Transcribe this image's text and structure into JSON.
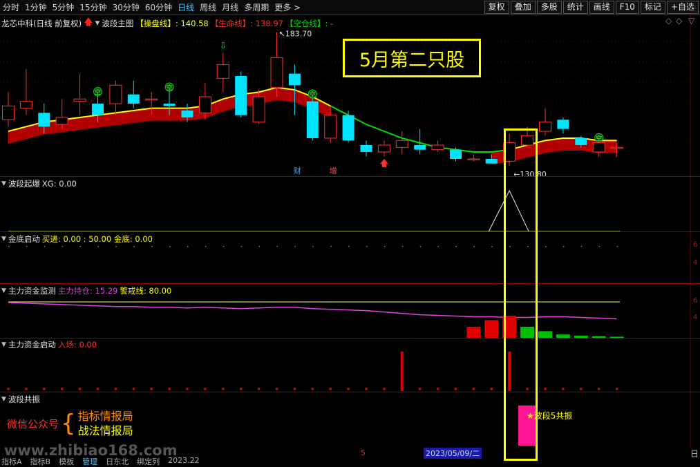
{
  "toolbar": {
    "periods": [
      "分时",
      "1分钟",
      "5分钟",
      "15分钟",
      "30分钟",
      "60分钟",
      "日线",
      "周线",
      "月线",
      "多周期",
      "更多 >"
    ],
    "active_period": "日线",
    "tools": [
      "复权",
      "叠加",
      "多股",
      "统计",
      "画线",
      "F10",
      "标记",
      "+自选"
    ]
  },
  "main_panel": {
    "stock_title": "龙芯中科(日线 前复权)",
    "indicator_name": "波段主图",
    "field1_label": "【操盘线】",
    "field1_value": ": 140.58",
    "field2_label": "【生命线】",
    "field2_value": ": 138.97",
    "field3_label": "【空仓线】",
    "field3_value": ": -",
    "high_label": "183.70",
    "low_label": "130.80",
    "signal_kong": "空",
    "tag_cai": "财",
    "tag_zeng": "增",
    "annotation": "5月第二只股"
  },
  "panels": {
    "p1": {
      "name": "波段起爆",
      "line": "XG: 0.00"
    },
    "p2": {
      "name": "金底启动",
      "line": "买进: 0.00 : 50.00 金底: 0.00"
    },
    "p3": {
      "name": "主力资金监测",
      "label1": "主力持仓: 15.29",
      "label2": "警戒线: 80.00"
    },
    "p4": {
      "name": "主力资金启动",
      "label1": "入场: 0.00"
    },
    "p5": {
      "name": "波段共振",
      "resonance": "★波段5共振"
    }
  },
  "branding": {
    "wechat_label": "微信公众号",
    "item1": "指标情报局",
    "item2": "战法情报局",
    "watermark": "www.zhibiao168.com"
  },
  "footer": {
    "date": "2023/05/09/二",
    "five": "5",
    "right_char": "日",
    "nav": [
      "指标A",
      "指标B",
      "模板",
      "管理",
      "日东北",
      "绑定列",
      "2023.22"
    ]
  },
  "colors": {
    "up": "#ff3030",
    "down": "#00e5ff",
    "band_fill": "#b00000",
    "yellow": "#ffff00",
    "green": "#00e000",
    "magenta": "#e040e0",
    "highlight": "#ffff00"
  },
  "chart_data": {
    "type": "candlestick",
    "price_high_marker": 183.7,
    "price_low_marker": 130.8,
    "candles": [
      {
        "o": 146,
        "c": 152,
        "h": 158,
        "l": 143
      },
      {
        "o": 151,
        "c": 154,
        "h": 168,
        "l": 148
      },
      {
        "o": 149,
        "c": 143,
        "h": 153,
        "l": 140
      },
      {
        "o": 144,
        "c": 147,
        "h": 155,
        "l": 142
      },
      {
        "o": 154,
        "c": 155,
        "h": 166,
        "l": 148
      },
      {
        "o": 153,
        "c": 148,
        "h": 157,
        "l": 145
      },
      {
        "o": 153,
        "c": 161,
        "h": 163,
        "l": 148
      },
      {
        "o": 157,
        "c": 153,
        "h": 163,
        "l": 151
      },
      {
        "o": 155,
        "c": 155,
        "h": 158,
        "l": 148
      },
      {
        "o": 153,
        "c": 152,
        "h": 159,
        "l": 148
      },
      {
        "o": 150,
        "c": 147,
        "h": 153,
        "l": 145
      },
      {
        "o": 149,
        "c": 156,
        "h": 162,
        "l": 146
      },
      {
        "o": 164,
        "c": 170,
        "h": 175,
        "l": 158
      },
      {
        "o": 165,
        "c": 148,
        "h": 167,
        "l": 147
      },
      {
        "o": 145,
        "c": 156,
        "h": 159,
        "l": 144
      },
      {
        "o": 160,
        "c": 173,
        "h": 184,
        "l": 156
      },
      {
        "o": 166,
        "c": 161,
        "h": 170,
        "l": 148
      },
      {
        "o": 154,
        "c": 138,
        "h": 156,
        "l": 137
      },
      {
        "o": 138,
        "c": 148,
        "h": 152,
        "l": 136
      },
      {
        "o": 148,
        "c": 137,
        "h": 150,
        "l": 136
      },
      {
        "o": 135,
        "c": 132,
        "h": 137,
        "l": 130
      },
      {
        "o": 132,
        "c": 135,
        "h": 137,
        "l": 130
      },
      {
        "o": 134,
        "c": 137,
        "h": 141,
        "l": 131
      },
      {
        "o": 135,
        "c": 133,
        "h": 142,
        "l": 131
      },
      {
        "o": 133,
        "c": 135,
        "h": 137,
        "l": 132
      },
      {
        "o": 133,
        "c": 129,
        "h": 134,
        "l": 128
      },
      {
        "o": 129,
        "c": 129,
        "h": 131,
        "l": 128
      },
      {
        "o": 129,
        "c": 127,
        "h": 131,
        "l": 127
      },
      {
        "o": 128,
        "c": 136,
        "h": 140,
        "l": 126
      },
      {
        "o": 135,
        "c": 139,
        "h": 143,
        "l": 134
      },
      {
        "o": 141,
        "c": 145,
        "h": 151,
        "l": 139
      },
      {
        "o": 146,
        "c": 142,
        "h": 147,
        "l": 140
      },
      {
        "o": 138,
        "c": 135,
        "h": 139,
        "l": 134
      },
      {
        "o": 132,
        "c": 136,
        "h": 137,
        "l": 130
      },
      {
        "o": 134,
        "c": 134,
        "h": 136,
        "l": 130
      }
    ],
    "trend_line": [
      141,
      143,
      145,
      146,
      147,
      148,
      149,
      150,
      151,
      151,
      151,
      152,
      155,
      157,
      158,
      160,
      159,
      156,
      152,
      148,
      144,
      141,
      138,
      136,
      134,
      133,
      132,
      132,
      133,
      135,
      137,
      138,
      138,
      137,
      137
    ],
    "main_capital": [
      52,
      51,
      50,
      49,
      48,
      47,
      46,
      46,
      45,
      45,
      44,
      45,
      44,
      43,
      44,
      45,
      45,
      43,
      42,
      41,
      40,
      38,
      36,
      34,
      33,
      32,
      31,
      31,
      30,
      30,
      31,
      31,
      30,
      29,
      28
    ],
    "capital_bars": [
      {
        "i": 26,
        "v": 20,
        "c": "red"
      },
      {
        "i": 27,
        "v": 32,
        "c": "red"
      },
      {
        "i": 28,
        "v": 40,
        "c": "red"
      },
      {
        "i": 29,
        "v": 20,
        "c": "green"
      },
      {
        "i": 30,
        "v": 12,
        "c": "green"
      },
      {
        "i": 31,
        "v": 6,
        "c": "green"
      },
      {
        "i": 32,
        "v": 4,
        "c": "green"
      },
      {
        "i": 33,
        "v": 3,
        "c": "green"
      },
      {
        "i": 34,
        "v": 2,
        "c": "green"
      }
    ],
    "entry_bars": [
      {
        "i": 22,
        "v": 1
      },
      {
        "i": 28,
        "v": 1
      }
    ],
    "xg_peak_index": 28
  }
}
